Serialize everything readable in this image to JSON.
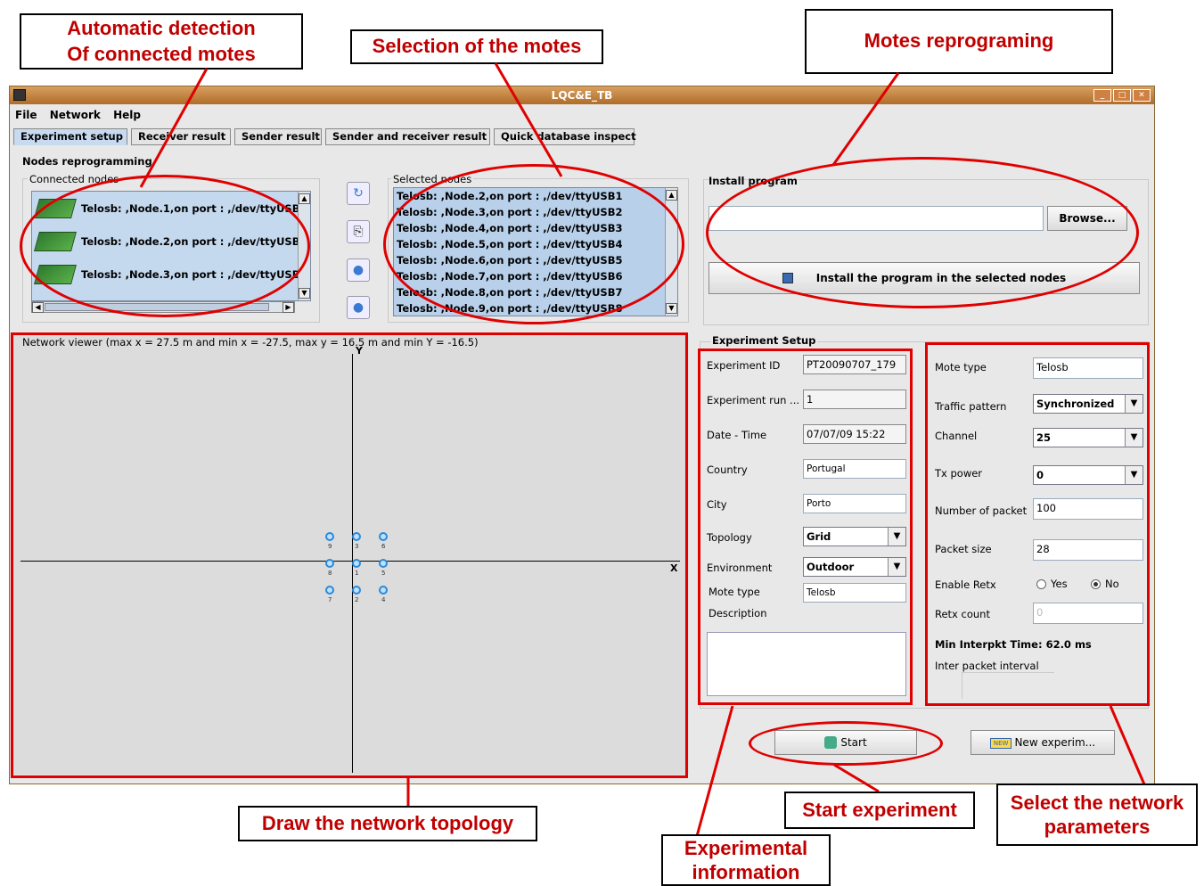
{
  "callouts": {
    "automatic_detection": "Automatic detection\nOf connected motes",
    "selection": "Selection of the motes",
    "reprograming": "Motes reprograming",
    "draw_topology": "Draw the network topology",
    "start_experiment": "Start experiment",
    "experimental_info": "Experimental information",
    "select_params": "Select the network parameters"
  },
  "window": {
    "title": "LQC&E_TB",
    "menu": [
      "File",
      "Network",
      "Help"
    ],
    "tabs": [
      "Experiment setup",
      "Receiver result",
      "Sender result",
      "Sender and receiver result",
      "Quick database inspect"
    ]
  },
  "reprog": {
    "section_title": "Nodes reprogramming",
    "connected_label": "Connected nodes",
    "connected": [
      "Telosb: ,Node.1,on port : ,/dev/ttyUSB",
      "Telosb: ,Node.2,on port : ,/dev/ttyUSB",
      "Telosb: ,Node.3,on port : ,/dev/ttyUSB"
    ],
    "selected_label": "Selected nodes",
    "selected": [
      "Telosb: ,Node.2,on port : ,/dev/ttyUSB1",
      "Telosb: ,Node.3,on port : ,/dev/ttyUSB2",
      "Telosb: ,Node.4,on port : ,/dev/ttyUSB3",
      "Telosb: ,Node.5,on port : ,/dev/ttyUSB4",
      "Telosb: ,Node.6,on port : ,/dev/ttyUSB5",
      "Telosb: ,Node.7,on port : ,/dev/ttyUSB6",
      "Telosb: ,Node.8,on port : ,/dev/ttyUSB7",
      "Telosb: ,Node.9,on port : ,/dev/ttyUSB8"
    ],
    "install_label": "Install program",
    "browse": "Browse...",
    "install_button": "Install the program in the selected nodes"
  },
  "viewer": {
    "title": "Network viewer (max x = 27.5 m and min x = -27.5, max y = 16.5 m and min Y = -16.5)",
    "x_axis": "X",
    "y_axis": "Y",
    "nodes": [
      {
        "label": "9",
        "col": 0,
        "row": 0
      },
      {
        "label": "3",
        "col": 1,
        "row": 0
      },
      {
        "label": "6",
        "col": 2,
        "row": 0
      },
      {
        "label": "8",
        "col": 0,
        "row": 1
      },
      {
        "label": "1",
        "col": 1,
        "row": 1
      },
      {
        "label": "5",
        "col": 2,
        "row": 1
      },
      {
        "label": "7",
        "col": 0,
        "row": 2
      },
      {
        "label": "2",
        "col": 1,
        "row": 2
      },
      {
        "label": "4",
        "col": 2,
        "row": 2
      }
    ]
  },
  "experiment": {
    "section_title": "Experiment Setup",
    "id_label": "Experiment ID",
    "id_value": "PT20090707_179",
    "run_label": "Experiment run ...",
    "run_value": "1",
    "date_label": "Date - Time",
    "date_value": "07/07/09 15:22",
    "country_label": "Country",
    "country_value": "Portugal",
    "city_label": "City",
    "city_value": "Porto",
    "topology_label": "Topology",
    "topology_value": "Grid",
    "env_label": "Environment",
    "env_value": "Outdoor",
    "mote_label": "Mote type",
    "mote_value": "Telosb",
    "desc_label": "Description"
  },
  "params": {
    "mote_label": "Mote type",
    "mote_value": "Telosb",
    "traffic_label": "Traffic pattern",
    "traffic_value": "Synchronized",
    "channel_label": "Channel",
    "channel_value": "25",
    "tx_label": "Tx power",
    "tx_value": "0",
    "npackets_label": "Number of packet",
    "npackets_value": "100",
    "psize_label": "Packet size",
    "psize_value": "28",
    "retx_label": "Enable Retx",
    "retx_yes": "Yes",
    "retx_no": "No",
    "retx_count_label": "Retx count",
    "retx_count_value": "0",
    "min_interpkt": "Min Interpkt Time:   62.0 ms",
    "inter_label": "Inter packet interval"
  },
  "actions": {
    "start": "Start",
    "new_badge": "NEW",
    "new_experiment": "New experim..."
  },
  "colors": {
    "highlight": "#e00000",
    "callout_text": "#c00000",
    "list_bg": "#b8d0ea"
  }
}
